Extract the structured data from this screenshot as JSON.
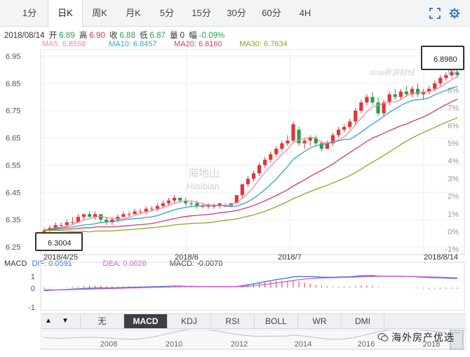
{
  "tabs": [
    {
      "label": "1分",
      "active": false
    },
    {
      "label": "日K",
      "active": true
    },
    {
      "label": "周K",
      "active": false
    },
    {
      "label": "月K",
      "active": false
    },
    {
      "label": "5分",
      "active": false
    },
    {
      "label": "15分",
      "active": false
    },
    {
      "label": "30分",
      "active": false
    },
    {
      "label": "60分",
      "active": false
    },
    {
      "label": "4H",
      "active": false
    }
  ],
  "info": {
    "date": "2018/08/14",
    "open_label": "开",
    "open": "6.89",
    "high_label": "高",
    "high": "6.90",
    "close_label": "收",
    "close": "6.88",
    "low_label": "低",
    "low": "6.87",
    "volume_label": "量",
    "volume": "0",
    "change_label": "幅",
    "change": "-0.09%"
  },
  "ma": [
    {
      "label": "MA5: 6.8558",
      "color": "#f08aa0"
    },
    {
      "label": "MA10: 6.8457",
      "color": "#2aa7c9"
    },
    {
      "label": "MA20: 6.8160",
      "color": "#d23a6a"
    },
    {
      "label": "MA30: 6.7634",
      "color": "#8aa824"
    }
  ],
  "callouts": {
    "high": "6.8980",
    "low": "6.3004"
  },
  "watermarks": {
    "sina": "sina新浪财经",
    "center1": "海地山",
    "center2": "Hiaibian"
  },
  "macd_info": {
    "label": "MACD",
    "dif": "DIF: 0.0591",
    "dea": "DEA: 0.0626",
    "macd": "MACD: -0.0070"
  },
  "indicator_tabs": [
    {
      "label": "无",
      "active": false
    },
    {
      "label": "MACD",
      "active": true
    },
    {
      "label": "KDJ",
      "active": false
    },
    {
      "label": "RSI",
      "active": false
    },
    {
      "label": "BOLL",
      "active": false
    },
    {
      "label": "WR",
      "active": false
    },
    {
      "label": "DMI",
      "active": false
    }
  ],
  "arrows": {
    "up": "▲",
    "down": "▼"
  },
  "navigator_years": [
    "2008",
    "2010",
    "2012",
    "2014",
    "2016",
    "2018"
  ],
  "wechat_brand": "海外房产优选",
  "colors": {
    "up": "#e3333a",
    "down": "#2a9d4a",
    "ma5": "#f08aa0",
    "ma10": "#2aa7c9",
    "ma20": "#d23a6a",
    "ma30": "#8aa824",
    "dif": "#3b6fd1",
    "dea": "#d05ad0"
  },
  "chart_data": {
    "type": "candlestick",
    "title": "",
    "y_ticks": [
      "6.95",
      "6.85",
      "6.75",
      "6.65",
      "6.55",
      "6.45",
      "6.35",
      "6.25"
    ],
    "y_pct_ticks": [
      "10%",
      "9%",
      "8%",
      "7%",
      "6%",
      "5%",
      "4%",
      "3%",
      "2%",
      "1%",
      "0%",
      "-1%"
    ],
    "x_ticks": [
      "2018/4/25",
      "2018/6",
      "2018/7",
      "2018/8/14"
    ],
    "ylim": [
      6.25,
      6.96
    ],
    "macd_y_ticks": [
      "1",
      "0",
      "-1"
    ],
    "candles": [
      [
        6.305,
        6.32,
        6.3,
        6.31
      ],
      [
        6.31,
        6.33,
        6.3,
        6.32
      ],
      [
        6.32,
        6.34,
        6.31,
        6.33
      ],
      [
        6.33,
        6.34,
        6.32,
        6.33
      ],
      [
        6.33,
        6.35,
        6.32,
        6.34
      ],
      [
        6.34,
        6.36,
        6.33,
        6.34
      ],
      [
        6.34,
        6.37,
        6.34,
        6.36
      ],
      [
        6.36,
        6.37,
        6.35,
        6.37
      ],
      [
        6.37,
        6.38,
        6.36,
        6.36
      ],
      [
        6.36,
        6.38,
        6.35,
        6.37
      ],
      [
        6.37,
        6.37,
        6.34,
        6.35
      ],
      [
        6.35,
        6.36,
        6.33,
        6.34
      ],
      [
        6.34,
        6.36,
        6.33,
        6.35
      ],
      [
        6.35,
        6.37,
        6.34,
        6.36
      ],
      [
        6.36,
        6.38,
        6.36,
        6.37
      ],
      [
        6.37,
        6.38,
        6.36,
        6.37
      ],
      [
        6.37,
        6.39,
        6.37,
        6.38
      ],
      [
        6.38,
        6.39,
        6.37,
        6.38
      ],
      [
        6.38,
        6.4,
        6.37,
        6.39
      ],
      [
        6.39,
        6.4,
        6.38,
        6.39
      ],
      [
        6.39,
        6.41,
        6.38,
        6.4
      ],
      [
        6.4,
        6.42,
        6.39,
        6.41
      ],
      [
        6.41,
        6.43,
        6.4,
        6.42
      ],
      [
        6.42,
        6.44,
        6.41,
        6.43
      ],
      [
        6.43,
        6.43,
        6.41,
        6.42
      ],
      [
        6.42,
        6.43,
        6.4,
        6.41
      ],
      [
        6.41,
        6.42,
        6.4,
        6.41
      ],
      [
        6.41,
        6.42,
        6.39,
        6.4
      ],
      [
        6.4,
        6.41,
        6.39,
        6.4
      ],
      [
        6.4,
        6.41,
        6.39,
        6.4
      ],
      [
        6.4,
        6.41,
        6.39,
        6.4
      ],
      [
        6.4,
        6.41,
        6.39,
        6.41
      ],
      [
        6.4,
        6.41,
        6.4,
        6.4
      ],
      [
        6.4,
        6.41,
        6.4,
        6.41
      ],
      [
        6.41,
        6.44,
        6.41,
        6.44
      ],
      [
        6.44,
        6.48,
        6.43,
        6.48
      ],
      [
        6.48,
        6.51,
        6.47,
        6.5
      ],
      [
        6.5,
        6.53,
        6.49,
        6.52
      ],
      [
        6.52,
        6.56,
        6.51,
        6.55
      ],
      [
        6.55,
        6.58,
        6.54,
        6.57
      ],
      [
        6.57,
        6.6,
        6.56,
        6.59
      ],
      [
        6.59,
        6.62,
        6.58,
        6.61
      ],
      [
        6.61,
        6.64,
        6.6,
        6.63
      ],
      [
        6.63,
        6.66,
        6.62,
        6.64
      ],
      [
        6.64,
        6.71,
        6.63,
        6.7
      ],
      [
        6.68,
        6.69,
        6.62,
        6.63
      ],
      [
        6.63,
        6.65,
        6.61,
        6.64
      ],
      [
        6.64,
        6.66,
        6.62,
        6.65
      ],
      [
        6.65,
        6.66,
        6.62,
        6.63
      ],
      [
        6.63,
        6.64,
        6.6,
        6.61
      ],
      [
        6.61,
        6.64,
        6.61,
        6.63
      ],
      [
        6.63,
        6.67,
        6.62,
        6.66
      ],
      [
        6.66,
        6.69,
        6.65,
        6.68
      ],
      [
        6.68,
        6.7,
        6.67,
        6.69
      ],
      [
        6.69,
        6.72,
        6.68,
        6.71
      ],
      [
        6.71,
        6.76,
        6.7,
        6.75
      ],
      [
        6.75,
        6.79,
        6.74,
        6.78
      ],
      [
        6.78,
        6.81,
        6.77,
        6.8
      ],
      [
        6.8,
        6.82,
        6.77,
        6.78
      ],
      [
        6.78,
        6.8,
        6.73,
        6.74
      ],
      [
        6.74,
        6.79,
        6.73,
        6.78
      ],
      [
        6.78,
        6.82,
        6.77,
        6.81
      ],
      [
        6.81,
        6.83,
        6.79,
        6.8
      ],
      [
        6.8,
        6.83,
        6.79,
        6.82
      ],
      [
        6.82,
        6.84,
        6.8,
        6.81
      ],
      [
        6.81,
        6.84,
        6.8,
        6.83
      ],
      [
        6.83,
        6.85,
        6.8,
        6.81
      ],
      [
        6.81,
        6.83,
        6.79,
        6.82
      ],
      [
        6.82,
        6.84,
        6.81,
        6.83
      ],
      [
        6.83,
        6.86,
        6.82,
        6.85
      ],
      [
        6.85,
        6.88,
        6.84,
        6.87
      ],
      [
        6.87,
        6.89,
        6.86,
        6.88
      ],
      [
        6.88,
        6.9,
        6.87,
        6.89
      ],
      [
        6.89,
        6.9,
        6.87,
        6.88
      ]
    ],
    "macd_dif": [
      -0.02,
      -0.018,
      -0.016,
      -0.014,
      -0.012,
      -0.01,
      -0.008,
      -0.006,
      -0.004,
      -0.003,
      -0.002,
      -0.003,
      -0.002,
      -0.001,
      0.0,
      0.001,
      0.002,
      0.003,
      0.004,
      0.005,
      0.006,
      0.007,
      0.008,
      0.009,
      0.009,
      0.008,
      0.008,
      0.007,
      0.006,
      0.006,
      0.005,
      0.005,
      0.005,
      0.005,
      0.007,
      0.012,
      0.018,
      0.024,
      0.031,
      0.038,
      0.045,
      0.051,
      0.057,
      0.062,
      0.07,
      0.071,
      0.071,
      0.071,
      0.07,
      0.068,
      0.067,
      0.067,
      0.068,
      0.069,
      0.07,
      0.073,
      0.076,
      0.078,
      0.078,
      0.075,
      0.074,
      0.074,
      0.073,
      0.073,
      0.072,
      0.071,
      0.069,
      0.067,
      0.065,
      0.064,
      0.063,
      0.062,
      0.06,
      0.059
    ],
    "macd_dea": [
      -0.015,
      -0.015,
      -0.015,
      -0.014,
      -0.014,
      -0.013,
      -0.012,
      -0.011,
      -0.01,
      -0.009,
      -0.008,
      -0.007,
      -0.006,
      -0.005,
      -0.004,
      -0.003,
      -0.002,
      -0.001,
      0.0,
      0.001,
      0.002,
      0.003,
      0.004,
      0.005,
      0.006,
      0.006,
      0.006,
      0.006,
      0.006,
      0.006,
      0.006,
      0.006,
      0.006,
      0.006,
      0.006,
      0.007,
      0.009,
      0.012,
      0.016,
      0.02,
      0.025,
      0.03,
      0.035,
      0.04,
      0.046,
      0.051,
      0.055,
      0.058,
      0.061,
      0.062,
      0.063,
      0.064,
      0.065,
      0.066,
      0.067,
      0.068,
      0.07,
      0.071,
      0.072,
      0.073,
      0.073,
      0.073,
      0.073,
      0.073,
      0.072,
      0.072,
      0.071,
      0.07,
      0.069,
      0.068,
      0.067,
      0.066,
      0.064,
      0.063
    ]
  }
}
